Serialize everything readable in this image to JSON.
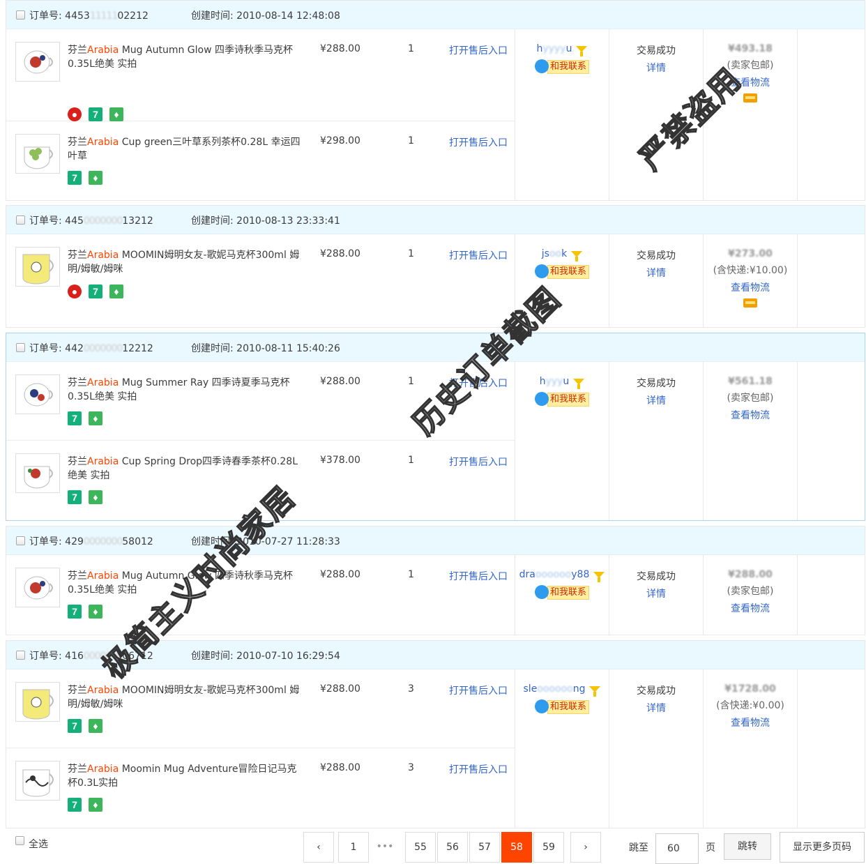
{
  "labels": {
    "order_no": "订单号: ",
    "created": "创建时间: ",
    "after_sale": "打开售后入口",
    "contact": "和我联系",
    "detail": "详情",
    "logistics": "查看物流",
    "tag_7": "7"
  },
  "orders": [
    {
      "no_pre": "4453",
      "no_mid": "11111",
      "no_post": "02212",
      "time": "2010-08-14 12:48:08",
      "buyer_pre": "h",
      "buyer_mid": "yyyy",
      "buyer_post": "u",
      "status": "交易成功",
      "amount": "¥493.18",
      "shipping": "(卖家包邮)",
      "items": [
        {
          "brand_pre": "芬兰",
          "brand": "Arabia",
          "name": " Mug Autumn Glow 四季诗秋季马克杯0.35L绝美 实拍",
          "price": "¥288.00",
          "qty": "1"
        },
        {
          "brand_pre": "芬兰",
          "brand": "Arabia",
          "name": " Cup green三叶草系列茶杯0.28L 幸运四叶草",
          "price": "¥298.00",
          "qty": "1"
        }
      ]
    },
    {
      "no_pre": "445",
      "no_mid": "0000000",
      "no_post": "13212",
      "time": "2010-08-13 23:33:41",
      "buyer_pre": "js",
      "buyer_mid": "oo",
      "buyer_post": "k",
      "status": "交易成功",
      "amount": "¥273.00",
      "shipping": "(含快递:¥10.00)",
      "items": [
        {
          "brand_pre": "芬兰",
          "brand": "Arabia",
          "name": " MOOMIN姆明女友-歌妮马克杯300ml 姆明/姆敏/姆咪",
          "price": "¥288.00",
          "qty": "1"
        }
      ]
    },
    {
      "no_pre": "442",
      "no_mid": "0000000",
      "no_post": "12212",
      "time": "2010-08-11 15:40:26",
      "buyer_pre": "h",
      "buyer_mid": "yyy",
      "buyer_post": "u",
      "status": "交易成功",
      "amount": "¥561.18",
      "shipping": "(卖家包邮)",
      "items": [
        {
          "brand_pre": "芬兰",
          "brand": "Arabia",
          "name": " Mug Summer Ray 四季诗夏季马克杯0.35L绝美 实拍",
          "price": "¥288.00",
          "qty": "1"
        },
        {
          "brand_pre": "芬兰",
          "brand": "Arabia",
          "name": " Cup Spring Drop四季诗春季茶杯0.28L绝美 实拍",
          "price": "¥378.00",
          "qty": "1"
        }
      ]
    },
    {
      "no_pre": "429",
      "no_mid": "0000000",
      "no_post": "58012",
      "time": "2010-07-27 11:28:33",
      "buyer_pre": "dra",
      "buyer_mid": "oooooo",
      "buyer_post": "y88",
      "status": "交易成功",
      "amount": "¥288.00",
      "shipping": "(卖家包邮)",
      "items": [
        {
          "brand_pre": "芬兰",
          "brand": "Arabia",
          "name": " Mug Autumn Glow 四季诗秋季马克杯0.35L绝美 实拍",
          "price": "¥288.00",
          "qty": "1"
        }
      ]
    },
    {
      "no_pre": "416",
      "no_mid": "0000000",
      "no_post": "06712",
      "time": "2010-07-10 16:29:54",
      "buyer_pre": "sle",
      "buyer_mid": "oooooo",
      "buyer_post": "ng",
      "status": "交易成功",
      "amount": "¥1728.00",
      "shipping": "(含快递:¥0.00)",
      "items": [
        {
          "brand_pre": "芬兰",
          "brand": "Arabia",
          "name": " MOOMIN姆明女友-歌妮马克杯300ml 姆明/姆敏/姆咪",
          "price": "¥288.00",
          "qty": "3"
        },
        {
          "brand_pre": "芬兰",
          "brand": "Arabia",
          "name": " Moomin Mug Adventure冒险日记马克杯0.3L实拍",
          "price": "¥288.00",
          "qty": "3"
        }
      ]
    }
  ],
  "watermarks": {
    "w1": "严禁盗用",
    "w2": "历史订单截图",
    "w3": "极简主义时尚家居"
  },
  "footer": {
    "select_all": "全选",
    "prev": "‹",
    "next": "›",
    "ellipsis": "•••",
    "pages": [
      "1",
      "55",
      "56",
      "57",
      "58",
      "59"
    ],
    "current_page": "58",
    "jump_to": "跳至",
    "jump_value": "60",
    "page_unit": "页",
    "go": "跳转",
    "more_pages": "显示更多页码"
  }
}
